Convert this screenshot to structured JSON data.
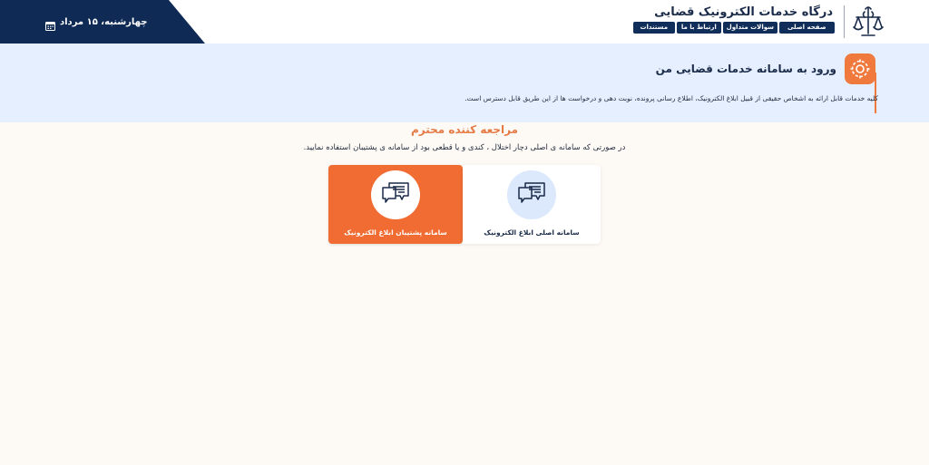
{
  "header": {
    "date": "چهارشنبه، ۱۵ مرداد",
    "title": "درگاه خدمات الکترونیک قضایی",
    "nav": [
      "صفحه اصلی",
      "سوالات متداول",
      "ارتباط با ما",
      "مستندات"
    ]
  },
  "banner": {
    "title": "ورود به سامانه خدمات قضایی من",
    "description": "کلیه خدمات قابل ارائه به اشخاص حقیقی از قبیل ابلاغ الکترونیک، اطلاع رسانی پرونده، نوبت دهی و درخواست ها از این طریق قابل دسترس است."
  },
  "main": {
    "greeting": "مراجعه کننده محترم",
    "notice": "در صورتی که سامانه ی اصلی دچار اختلال ، کندی و یا قطعی بود از سامانه ی پشتیبان استفاده نمایید.",
    "cards": {
      "backup_label": "سامانه پشتیبان ابلاغ الکترونیک",
      "main_label": "سامانه اصلی ابلاغ الکترونیک"
    }
  },
  "colors": {
    "navy": "#0f2b55",
    "accent_orange": "#f06c32",
    "banner_bg": "#e6efff",
    "page_bg": "#fdf9f4"
  },
  "icons": {
    "date": "calendar-icon",
    "brand": "judiciary-emblem-icon",
    "banner": "settings-gear-icon",
    "cards": "chat-message-icon"
  }
}
